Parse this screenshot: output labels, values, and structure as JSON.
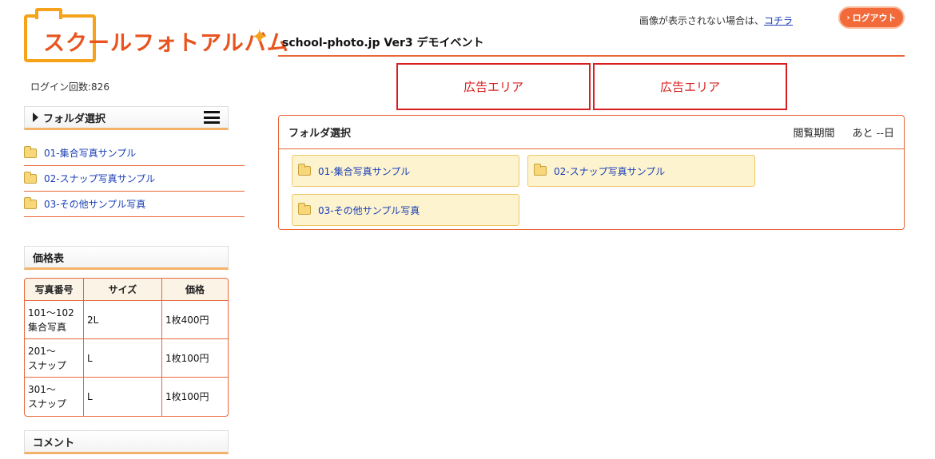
{
  "header": {
    "logo_text": "スクールフォトアルバム",
    "site_title": "school-photo.jp Ver3 デモイベント",
    "notice_text": "画像が表示されない場合は、",
    "notice_link": "コチラ",
    "logout_label": "ログアウト"
  },
  "sidebar": {
    "login_count": "ログイン回数:826",
    "folder_header": "フォルダ選択",
    "folders": [
      {
        "label": "01-集合写真サンプル"
      },
      {
        "label": "02-スナップ写真サンプル"
      },
      {
        "label": "03-その他サンプル写真"
      }
    ],
    "price_header": "価格表",
    "price_table": {
      "columns": [
        "写真番号",
        "サイズ",
        "価格"
      ],
      "rows": [
        {
          "number_line1": "101～102",
          "number_line2": "集合写真",
          "size": "2L",
          "price": "1枚400円"
        },
        {
          "number_line1": "201～",
          "number_line2": "スナップ",
          "size": "L",
          "price": "1枚100円"
        },
        {
          "number_line1": "301～",
          "number_line2": "スナップ",
          "size": "L",
          "price": "1枚100円"
        }
      ]
    },
    "comment_header": "コメント"
  },
  "ads": [
    {
      "label": "広告エリア"
    },
    {
      "label": "広告エリア"
    }
  ],
  "main": {
    "title": "フォルダ選択",
    "period_label": "閲覧期間",
    "period_value": "あと --日",
    "folders": [
      {
        "label": "01-集合写真サンプル"
      },
      {
        "label": "02-スナップ写真サンプル"
      },
      {
        "label": "03-その他サンプル写真"
      }
    ]
  },
  "colors": {
    "accent": "#e8683a",
    "logo_orange": "#e8531e",
    "logo_yellow": "#f5a31a",
    "ad_red": "#d81e1e",
    "link_blue": "#1a3fb5",
    "card_bg": "#fdf3cf"
  }
}
